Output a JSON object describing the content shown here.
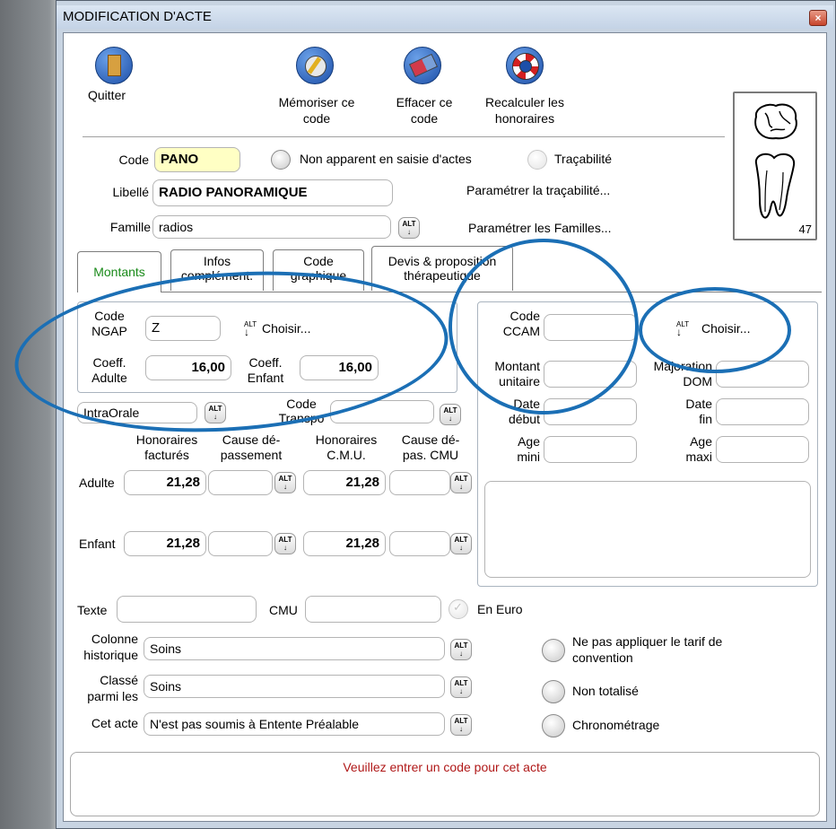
{
  "window": {
    "title": "MODIFICATION D'ACTE",
    "close": "×"
  },
  "toolbar": {
    "quit": "Quitter",
    "memorize": [
      "Mémoriser ce",
      "code"
    ],
    "erase": [
      "Effacer ce",
      "code"
    ],
    "recalc": [
      "Recalculer les",
      "honoraires"
    ]
  },
  "tooth_number": "47",
  "code": {
    "label": "Code",
    "value": "PANO"
  },
  "non_apparent": "Non apparent en saisie d'actes",
  "tracabilite": "Traçabilité",
  "libelle": {
    "label": "Libellé",
    "value": "RADIO PANORAMIQUE"
  },
  "param_tracabilite": "Paramétrer la traçabilité...",
  "famille": {
    "label": "Famille",
    "value": "radios"
  },
  "param_familles": "Paramétrer les Familles...",
  "tabs": [
    {
      "label": [
        "Montants"
      ],
      "active": true
    },
    {
      "label": [
        "Infos",
        "complément."
      ]
    },
    {
      "label": [
        "Code",
        "graphique"
      ]
    },
    {
      "label": [
        "Devis & proposition",
        "thérapeutique"
      ]
    }
  ],
  "ngap": {
    "code_label": [
      "Code",
      "NGAP"
    ],
    "code_value": "Z",
    "choose": "Choisir...",
    "coeff_adulte_label": [
      "Coeff.",
      "Adulte"
    ],
    "coeff_adulte": "16,00",
    "coeff_enfant_label": [
      "Coeff.",
      "Enfant"
    ],
    "coeff_enfant": "16,00"
  },
  "localisation": "IntraOrale",
  "code_transpo": [
    "Code",
    "Transpo"
  ],
  "ccam": {
    "code_label": [
      "Code",
      "CCAM"
    ],
    "choose": "Choisir...",
    "montant_label": [
      "Montant",
      "unitaire"
    ],
    "majoration_label": [
      "Majoration",
      "DOM"
    ],
    "date_debut_label": [
      "Date",
      "début"
    ],
    "date_fin_label": [
      "Date",
      "fin"
    ],
    "age_mini_label": [
      "Age",
      "mini"
    ],
    "age_maxi_label": [
      "Age",
      "maxi"
    ]
  },
  "fees": {
    "headers": [
      [
        "Honoraires",
        "facturés"
      ],
      [
        "Cause dé-",
        "passement"
      ],
      [
        "Honoraires",
        "C.M.U."
      ],
      [
        "Cause dé-",
        "pas. CMU"
      ]
    ],
    "rows": [
      {
        "label": "Adulte",
        "honoraires": "21,28",
        "cmu": "21,28"
      },
      {
        "label": "Enfant",
        "honoraires": "21,28",
        "cmu": "21,28"
      }
    ]
  },
  "texte_label": "Texte",
  "cmu_label": "CMU",
  "en_euro": "En Euro",
  "colonne_historique": {
    "label": [
      "Colonne",
      "historique"
    ],
    "value": "Soins"
  },
  "classe_parmi": {
    "label": [
      "Classé",
      "parmi les"
    ],
    "value": "Soins"
  },
  "cet_acte": {
    "label": "Cet acte",
    "value": "N'est pas soumis à Entente Préalable"
  },
  "options": {
    "ne_pas_appliquer": [
      "Ne pas appliquer le tarif de",
      "convention"
    ],
    "non_totalise": "Non totalisé",
    "chronometrage": "Chronométrage"
  },
  "status_message": "Veuillez entrer un code pour cet acte",
  "alt_label": "ALT",
  "colors": {
    "accent_oval": "#1b6fb5",
    "message": "#b01818",
    "active_tab": "#1a8a1a",
    "code_field": "#ffffc4"
  }
}
